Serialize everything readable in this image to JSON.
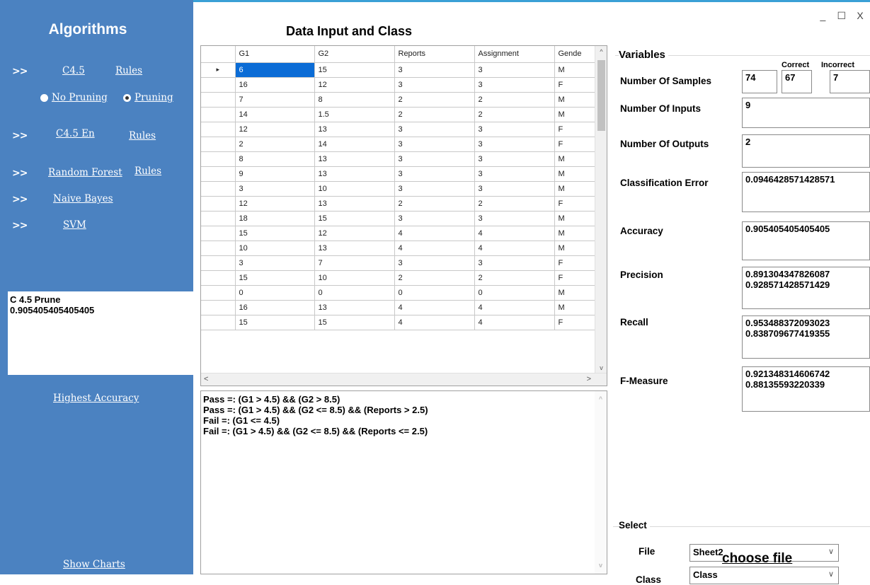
{
  "sidebar": {
    "title": "Algorithms",
    "arrow": ">>",
    "c45": "C4.5",
    "c45_rules": "Rules",
    "no_pruning": "No Pruning",
    "pruning": "Pruning",
    "c45en": "C4.5 En",
    "c45en_rules": "Rules",
    "random_forest": "Random Forest",
    "random_forest_rules": "Rules",
    "naive_bayes": "Naive Bayes",
    "svm": "SVM",
    "result_line1": "C 4.5 Prune",
    "result_line2": "0.905405405405405",
    "highest_accuracy": "Highest Accuracy",
    "show_charts": "Show Charts"
  },
  "window": {
    "minimize": "_",
    "maximize": "☐",
    "close": "X"
  },
  "main": {
    "title": "Data Input and Class",
    "grid": {
      "columns": [
        "G1",
        "G2",
        "Reports",
        "Assignment",
        "Gende"
      ],
      "rows": [
        [
          "6",
          "15",
          "3",
          "3",
          "M"
        ],
        [
          "16",
          "12",
          "3",
          "3",
          "F"
        ],
        [
          "7",
          "8",
          "2",
          "2",
          "M"
        ],
        [
          "14",
          "1.5",
          "2",
          "2",
          "M"
        ],
        [
          "12",
          "13",
          "3",
          "3",
          "F"
        ],
        [
          "2",
          "14",
          "3",
          "3",
          "F"
        ],
        [
          "8",
          "13",
          "3",
          "3",
          "M"
        ],
        [
          "9",
          "13",
          "3",
          "3",
          "M"
        ],
        [
          "3",
          "10",
          "3",
          "3",
          "M"
        ],
        [
          "12",
          "13",
          "2",
          "2",
          "F"
        ],
        [
          "18",
          "15",
          "3",
          "3",
          "M"
        ],
        [
          "15",
          "12",
          "4",
          "4",
          "M"
        ],
        [
          "10",
          "13",
          "4",
          "4",
          "M"
        ],
        [
          "3",
          "7",
          "3",
          "3",
          "F"
        ],
        [
          "15",
          "10",
          "2",
          "2",
          "F"
        ],
        [
          "0",
          "0",
          "0",
          "0",
          "M"
        ],
        [
          "16",
          "13",
          "4",
          "4",
          "M"
        ],
        [
          "15",
          "15",
          "4",
          "4",
          "F"
        ]
      ]
    },
    "rules": [
      "Pass =: (G1 > 4.5) && (G2 > 8.5)",
      "Pass =: (G1 > 4.5) && (G2 <= 8.5) && (Reports > 2.5)",
      "Fail =: (G1 <= 4.5)",
      "Fail =: (G1 > 4.5) && (G2 <= 8.5) && (Reports <= 2.5)"
    ]
  },
  "variables": {
    "title": "Variables",
    "correct_label": "Correct",
    "incorrect_label": "Incorrect",
    "samples_label": "Number Of Samples",
    "samples": "74",
    "correct": "67",
    "incorrect": "7",
    "inputs_label": "Number Of Inputs",
    "inputs": "9",
    "outputs_label": "Number Of Outputs",
    "outputs": "2",
    "error_label": "Classification Error",
    "error": "0.0946428571428571",
    "accuracy_label": "Accuracy",
    "accuracy": "0.905405405405405",
    "precision_label": "Precision",
    "precision_1": "0.891304347826087",
    "precision_2": "0.928571428571429",
    "recall_label": "Recall",
    "recall_1": "0.953488372093023",
    "recall_2": "0.838709677419355",
    "fmeasure_label": "F-Measure",
    "fmeasure_1": "0.921348314606742",
    "fmeasure_2": "0.88135593220339"
  },
  "select": {
    "title": "Select",
    "file_label": "File",
    "file_value": "Sheet2",
    "class_label": "Class",
    "class_value": "Class",
    "choose_file": "choose file"
  }
}
